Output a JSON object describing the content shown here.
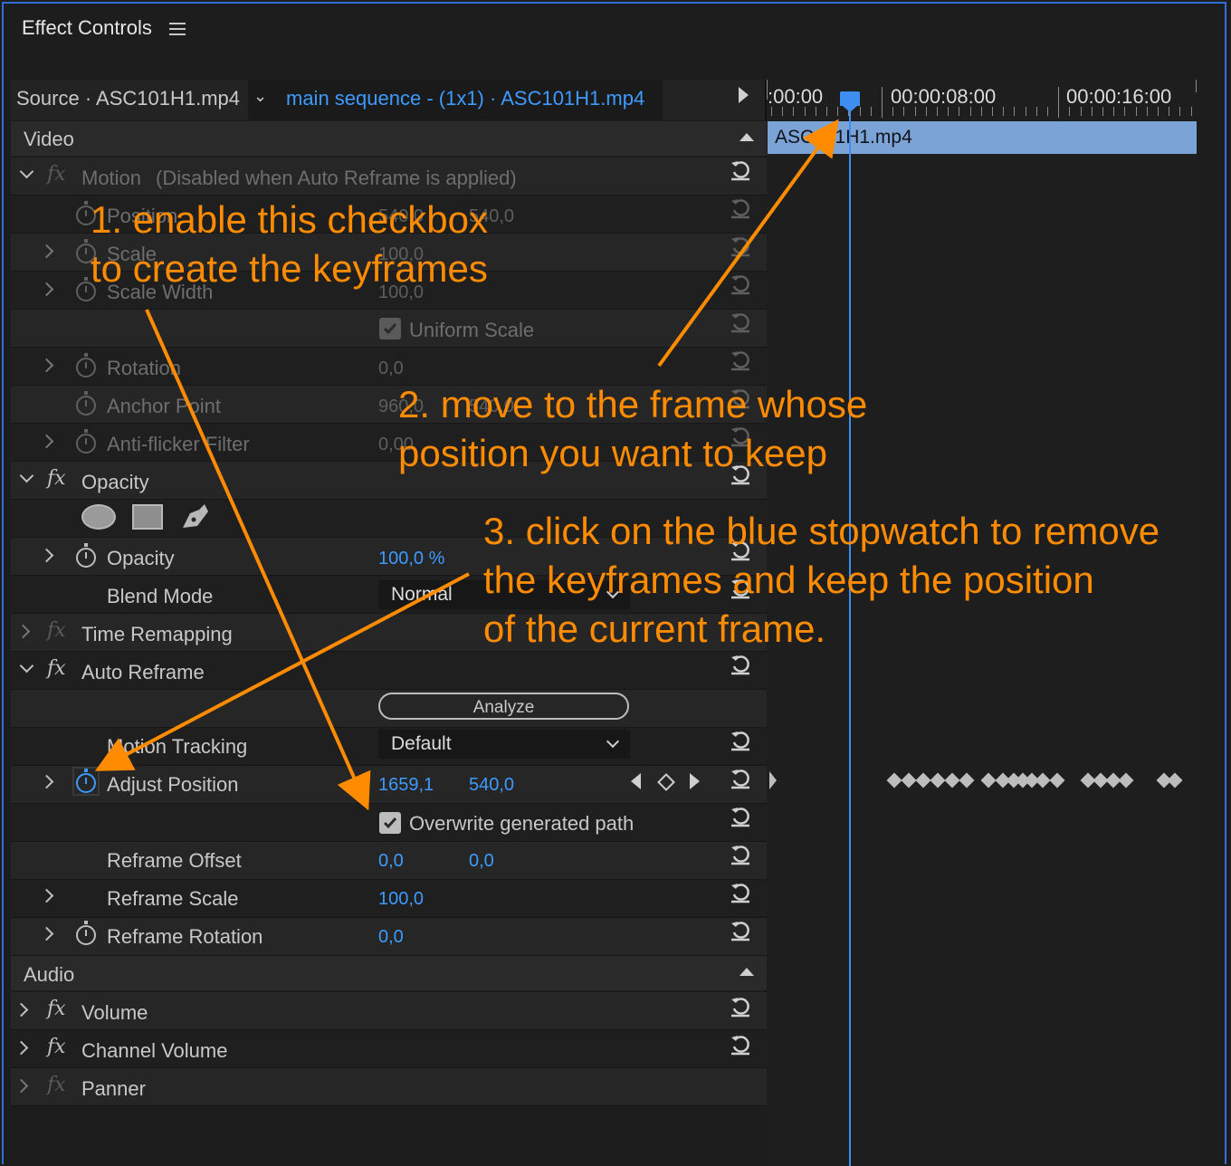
{
  "panel": {
    "title": "Effect Controls",
    "menu_icon": "hamburger-menu-icon"
  },
  "source_bar": {
    "source": "Source · ASC101H1.mp4",
    "sequence": "main sequence - (1x1) · ASC101H1.mp4"
  },
  "timeline": {
    "tc_start": ":00:00",
    "tc_mid": "00:00:08:00",
    "tc_end": "00:00:16:00",
    "clip": "ASC101H1.mp4"
  },
  "video": {
    "section_label": "Video",
    "motion": {
      "name": "Motion",
      "note": "(Disabled when Auto Reframe is applied)"
    },
    "position": {
      "label": "Position",
      "x": "540,0",
      "y": "540,0"
    },
    "scale": {
      "label": "Scale",
      "value": "100,0"
    },
    "scale_width": {
      "label": "Scale Width",
      "value": "100,0"
    },
    "uniform_scale": {
      "label": "Uniform Scale",
      "checked": true
    },
    "rotation": {
      "label": "Rotation",
      "value": "0,0"
    },
    "anchor_point": {
      "label": "Anchor Point",
      "x": "960,0",
      "y": "540,0"
    },
    "anti_flicker": {
      "label": "Anti-flicker Filter",
      "value": "0,00"
    },
    "opacity_fx": {
      "name": "Opacity"
    },
    "mask_tools": [
      "ellipse-mask-icon",
      "rectangle-mask-icon",
      "pen-mask-icon"
    ],
    "opacity": {
      "label": "Opacity",
      "value": "100,0 %"
    },
    "blend_mode": {
      "label": "Blend Mode",
      "value": "Normal"
    },
    "time_remapping": {
      "name": "Time Remapping"
    },
    "auto_reframe": {
      "name": "Auto Reframe",
      "analyze_label": "Analyze"
    },
    "motion_tracking": {
      "label": "Motion Tracking",
      "value": "Default"
    },
    "adjust_position": {
      "label": "Adjust Position",
      "x": "1659,1",
      "y": "540,0"
    },
    "overwrite_path": {
      "label": "Overwrite generated path",
      "checked": true
    },
    "reframe_offset": {
      "label": "Reframe Offset",
      "x": "0,0",
      "y": "0,0"
    },
    "reframe_scale": {
      "label": "Reframe Scale",
      "value": "100,0"
    },
    "reframe_rotation": {
      "label": "Reframe Rotation",
      "value": "0,0"
    }
  },
  "audio": {
    "section_label": "Audio",
    "volume": {
      "name": "Volume"
    },
    "channel_volume": {
      "name": "Channel Volume"
    },
    "panner": {
      "name": "Panner"
    }
  },
  "annotations": {
    "note1": [
      "1. enable this checkbox",
      "to create the keyframes"
    ],
    "note2": [
      "2. move to the frame whose",
      "position you want to keep"
    ],
    "note3": [
      "3. click on the blue stopwatch to remove",
      "the keyframes and keep the position",
      "of the current frame."
    ]
  },
  "colors": {
    "accent_blue": "#3d9bff",
    "annotation_orange": "#ff8c00",
    "clip_blue": "#7ba3d6"
  }
}
